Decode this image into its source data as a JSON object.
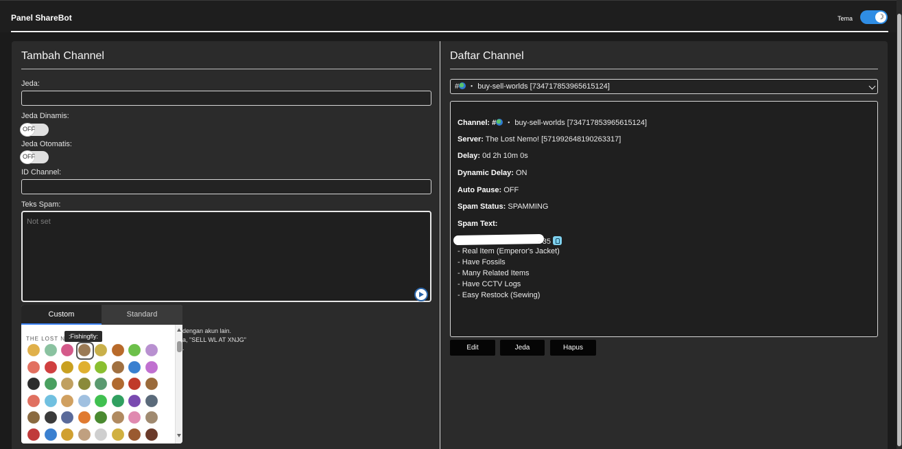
{
  "header": {
    "title": "Panel ShareBot",
    "theme_label": "Tema",
    "theme_toggle": {
      "state": "on",
      "icon": "moon-icon",
      "color": "#2f8de4"
    }
  },
  "left": {
    "title": "Tambah Channel",
    "jeda": {
      "label": "Jeda:",
      "value": ""
    },
    "jeda_dinamis": {
      "label": "Jeda Dinamis:",
      "state_text": "OFF"
    },
    "jeda_otomatis": {
      "label": "Jeda Otomatis:",
      "state_text": "OFF"
    },
    "id_channel": {
      "label": "ID Channel:",
      "value": ""
    },
    "teks_spam": {
      "label": "Teks Spam:",
      "placeholder": "Not set"
    },
    "hint_lines": [
      "dengan akun lain.",
      "a, \"SELL WL AT XNJG\"",
      "."
    ],
    "emoji_picker": {
      "tabs": [
        "Custom",
        "Standard"
      ],
      "active_tab": "Custom",
      "section_label": "THE LOST N",
      "tooltip": ":Fishingfly:",
      "emoji_colors": [
        "#e0b04a",
        "#8ac2a0",
        "#d45a8a",
        "#9a7a55",
        "#c9b04a",
        "#b86a2a",
        "#6cc04a",
        "#b890d0",
        "#e27060",
        "#d04040",
        "#c9a020",
        "#e0b030",
        "#8abf30",
        "#a07040",
        "#3a80d0",
        "#c070d0",
        "#2c2c2c",
        "#4aa060",
        "#c0a060",
        "#8a8a3a",
        "#5a9a70",
        "#b06a30",
        "#c03a2a",
        "#9a6a3a",
        "#e07060",
        "#70c0e0",
        "#d0a060",
        "#a0c0e0",
        "#40c050",
        "#30a060",
        "#7a4ab0",
        "#5a6a7a",
        "#8a6a40",
        "#3a3a3a",
        "#5a6a9a",
        "#e07a30",
        "#4a8a30",
        "#b08a60",
        "#e08ab0",
        "#a08a70",
        "#c03a3a",
        "#3a80d0",
        "#d0a030",
        "#c0a080",
        "#cfcfcf",
        "#d0b040",
        "#9a5a30",
        "#6a3a2a"
      ],
      "selected_index": 3
    }
  },
  "right": {
    "title": "Daftar Channel",
    "select_value": "#\u0001 ・ buy-sell-worlds [734717853965615124]",
    "select_prefix": "#",
    "select_text": " ・ buy-sell-worlds [734717853965615124]",
    "details": {
      "channel_label": "Channel:",
      "channel_prefix": " #",
      "channel_value": " ・ buy-sell-worlds [734717853965615124]",
      "server_label": "Server:",
      "server_value": " The Lost Nemo! [571992648190263317]",
      "delay_label": "Delay:",
      "delay_value": " 0d 2h 10m 0s",
      "dynamic_label": "Dynamic Delay:",
      "dynamic_value": " ON",
      "autopause_label": "Auto Pause:",
      "autopause_value": " OFF",
      "status_label": "Spam Status:",
      "status_value": " SPAMMING",
      "spamtext_label": "Spam Text:",
      "spam_first_line_visible": "- 35",
      "spam_lines": [
        "- Real Item (Emperor's Jacket)",
        "- Have Fossils",
        "- Many Related Items",
        "- Have CCTV Logs",
        "- Easy Restock (Sewing)"
      ]
    },
    "buttons": {
      "edit": "Edit",
      "pause": "Jeda",
      "delete": "Hapus"
    }
  }
}
